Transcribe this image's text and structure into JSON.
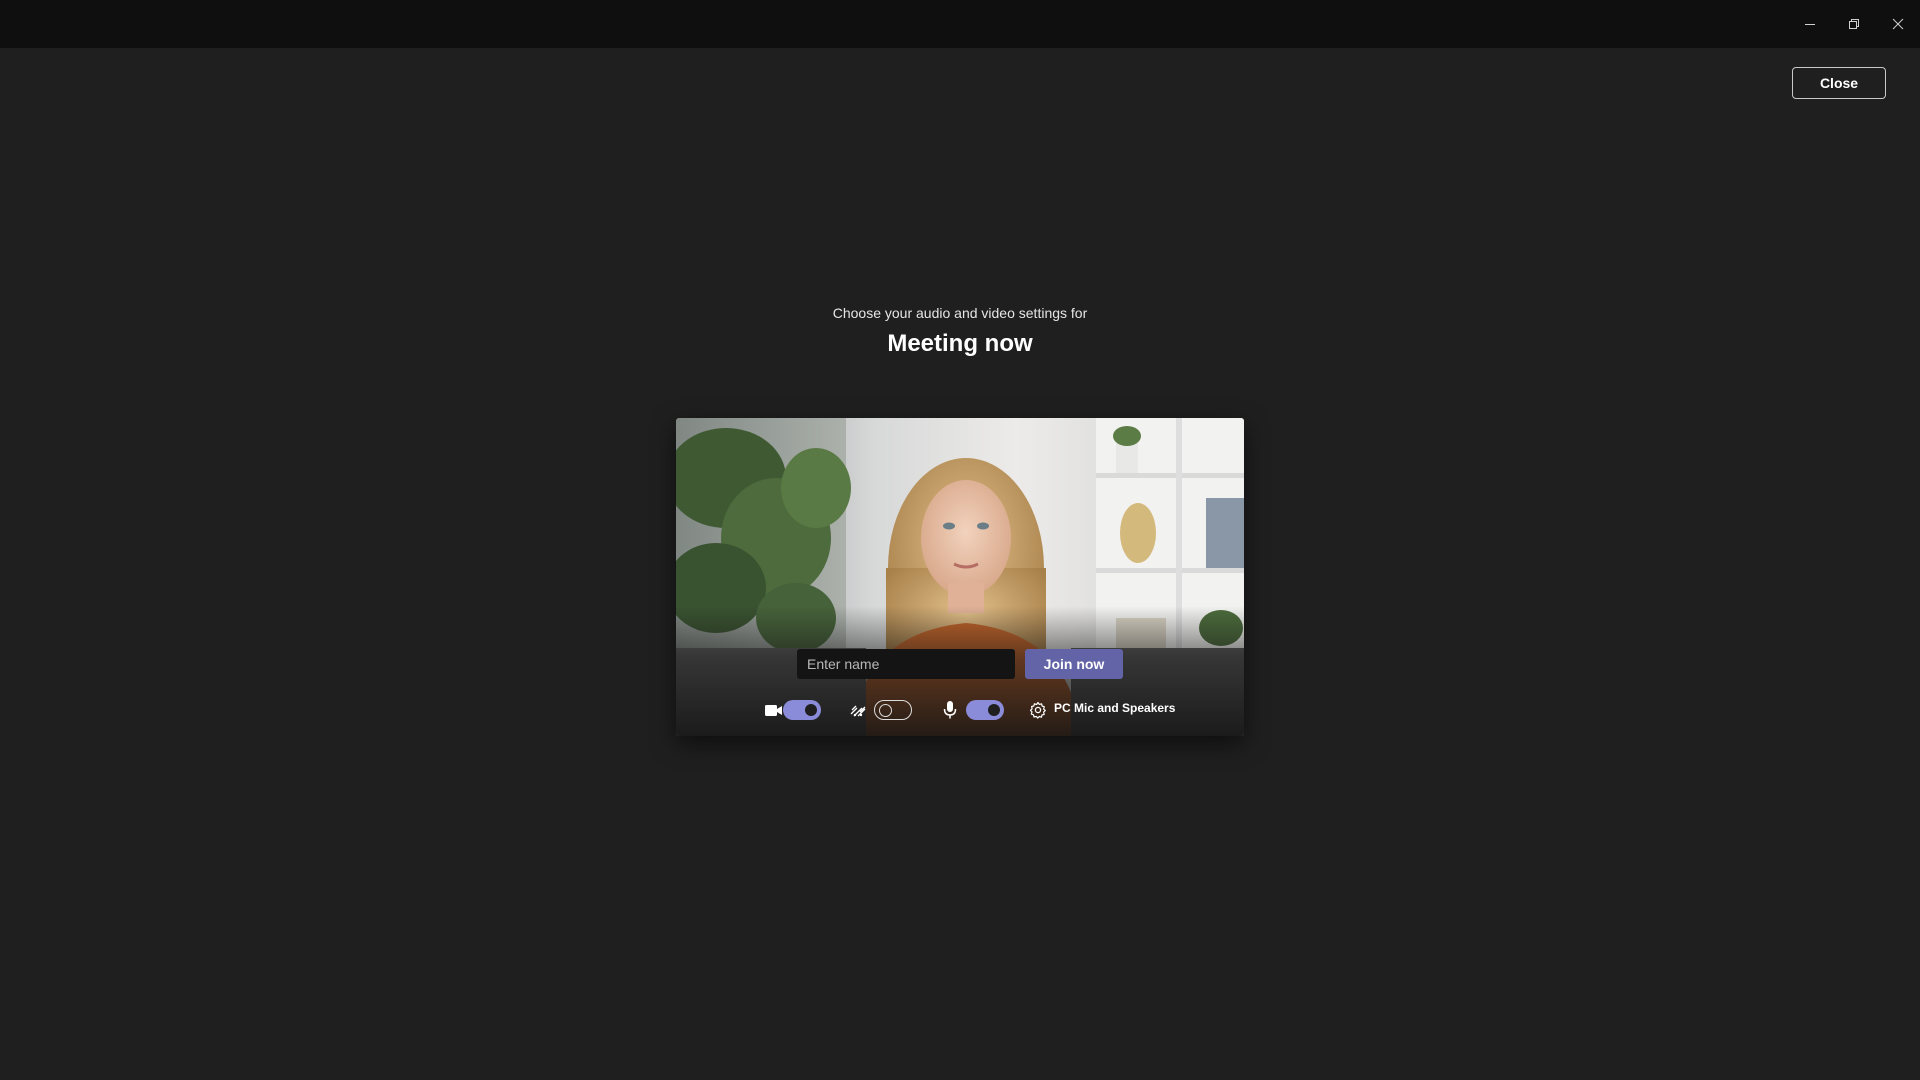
{
  "window": {
    "controls": [
      "minimize-icon",
      "restore-icon",
      "close-icon"
    ]
  },
  "header": {
    "close_label": "Close"
  },
  "prejoin": {
    "subtitle": "Choose your audio and video settings for",
    "meeting_title": "Meeting now",
    "name_placeholder": "Enter name",
    "name_value": "",
    "join_label": "Join now",
    "camera_on": true,
    "background_effects_on": false,
    "mic_on": true,
    "device_label": "PC Mic and Speakers"
  },
  "colors": {
    "background": "#1f1f1f",
    "titlebar": "#0f0f0f",
    "accent": "#6264a7",
    "toggle_on": "#8b8cd9"
  }
}
